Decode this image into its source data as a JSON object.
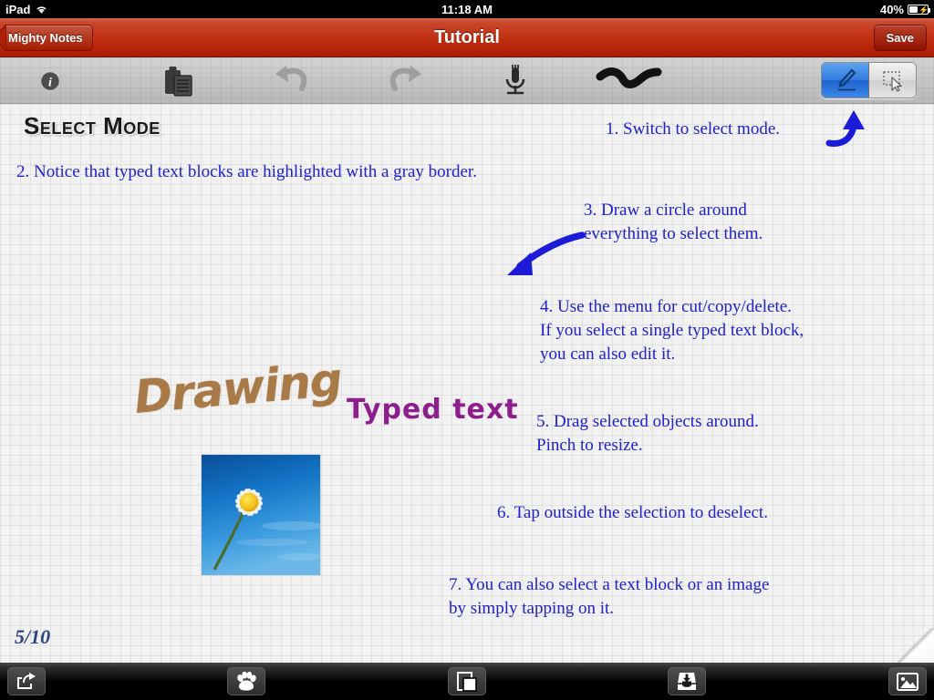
{
  "status_bar": {
    "device": "iPad",
    "wifi_icon": "wifi-icon",
    "time": "11:18 AM",
    "battery_percent": "40%",
    "battery_icon": "battery-charging-icon"
  },
  "nav_bar": {
    "back_label": "Mighty Notes",
    "title": "Tutorial",
    "save_label": "Save",
    "bg_top": "#d4634a",
    "bg_bottom": "#ad1c04"
  },
  "toolbar": {
    "buttons": [
      {
        "name": "info-icon",
        "label": "Info"
      },
      {
        "name": "paste-icon",
        "label": "Paste"
      },
      {
        "name": "undo-icon",
        "label": "Undo"
      },
      {
        "name": "redo-icon",
        "label": "Redo"
      },
      {
        "name": "microphone-icon",
        "label": "Record Audio"
      },
      {
        "name": "scribble-icon",
        "label": "Ink Stroke"
      }
    ],
    "mode_segment": {
      "selected": "pen",
      "options": [
        {
          "value": "pen",
          "name": "pen-icon",
          "label": "Draw"
        },
        {
          "value": "select",
          "name": "marquee-select-icon",
          "label": "Select"
        }
      ],
      "selected_color": "#3e87e8"
    }
  },
  "page": {
    "title": "Select Mode",
    "page_number": "5/10",
    "drawing_word": "Drawing",
    "drawing_color": "#a87a48",
    "typed_text": "Typed\ntext",
    "typed_text_color": "#8e1d8e",
    "photo_alt": "daisy-flower-photo",
    "note_color": "#2020cc",
    "notes": [
      {
        "id": "note-1",
        "text": "1. Switch to select mode."
      },
      {
        "id": "note-2",
        "text": "2. Notice that typed text blocks are highlighted with a gray border."
      },
      {
        "id": "note-3",
        "text": "3. Draw a circle around\n     everything to select them."
      },
      {
        "id": "note-4",
        "text": "4. Use the menu for cut/copy/delete.\n    If you select a single typed text block,\n    you can also edit it."
      },
      {
        "id": "note-5",
        "text": "5. Drag selected objects around.\n    Pinch to resize."
      },
      {
        "id": "note-6",
        "text": "6. Tap outside the selection to deselect."
      },
      {
        "id": "note-7",
        "text": "7. You can also select a text block or an image\n    by simply tapping on it."
      }
    ],
    "annotations": [
      {
        "name": "arrow-up-right-to-toolbar",
        "color": "#1b1bd8"
      },
      {
        "name": "arrow-down-left-to-canvas",
        "color": "#1b1bd8"
      }
    ]
  },
  "bottom_bar": {
    "buttons": [
      {
        "name": "share-icon",
        "label": "Share"
      },
      {
        "name": "paw-icon",
        "label": "Stickers"
      },
      {
        "name": "pages-icon",
        "label": "Pages"
      },
      {
        "name": "inbox-icon",
        "label": "Import"
      },
      {
        "name": "photo-icon",
        "label": "Insert Image"
      }
    ]
  }
}
